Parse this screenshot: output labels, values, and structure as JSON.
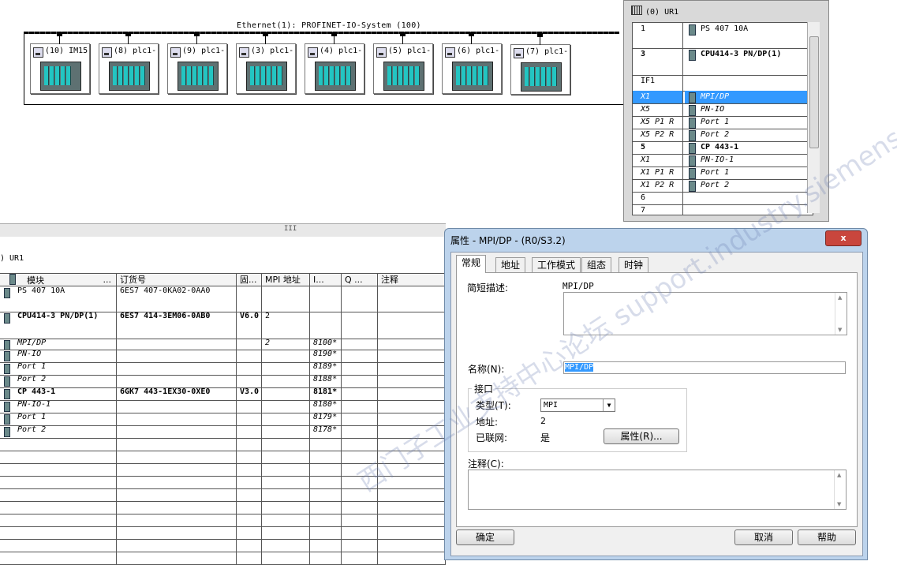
{
  "network": {
    "label": "Ethernet(1): PROFINET-IO-System (100)",
    "devices": [
      "(10) IM15",
      "(8) plc1-",
      "(9) plc1-",
      "(3) plc1-",
      "(4) plc1-",
      "(5) plc1-",
      "(6) plc1-",
      "(7) plc1-"
    ]
  },
  "rack": {
    "title": "(0) UR1",
    "rows": [
      {
        "slot": "1",
        "module": "PS 407 10A"
      },
      {
        "slot": "3",
        "module": "CPU414-3 PN/DP(1)"
      },
      {
        "slot": "IF1",
        "module": ""
      },
      {
        "slot": "X1",
        "module": "MPI/DP"
      },
      {
        "slot": "X5",
        "module": "PN-IO"
      },
      {
        "slot": "X5 P1 R",
        "module": "Port 1"
      },
      {
        "slot": "X5 P2 R",
        "module": "Port 2"
      },
      {
        "slot": "5",
        "module": "CP 443-1"
      },
      {
        "slot": "X1",
        "module": "PN-IO-1"
      },
      {
        "slot": "X1 P1 R",
        "module": "Port 1"
      },
      {
        "slot": "X1 P2 R",
        "module": "Port 2"
      },
      {
        "slot": "6",
        "module": ""
      },
      {
        "slot": "7",
        "module": ""
      }
    ]
  },
  "splitter": {
    "grip": "III"
  },
  "table": {
    "rack_label": ")   UR1",
    "headers": {
      "module": "模块",
      "dots": "...",
      "order": "订货号",
      "firmware": "固...",
      "mpi": "MPI 地址",
      "i": "I...",
      "q": "Q ...",
      "comment": "注释"
    },
    "rows": [
      {
        "module": "PS 407 10A",
        "order": "6ES7 407-0KA02-0AA0",
        "firmware": "",
        "mpi": "",
        "i": ""
      },
      {
        "module": "CPU414-3 PN/DP(1)",
        "order": "6ES7 414-3EM06-0AB0",
        "firmware": "V6.0",
        "mpi": "2",
        "i": ""
      },
      {
        "module": "MPI/DP",
        "order": "",
        "firmware": "",
        "mpi": "2",
        "i": "8100*"
      },
      {
        "module": "PN-IO",
        "order": "",
        "firmware": "",
        "mpi": "",
        "i": "8190*"
      },
      {
        "module": "Port 1",
        "order": "",
        "firmware": "",
        "mpi": "",
        "i": "8189*"
      },
      {
        "module": "Port 2",
        "order": "",
        "firmware": "",
        "mpi": "",
        "i": "8188*"
      },
      {
        "module": "CP 443-1",
        "order": "6GK7 443-1EX30-0XE0",
        "firmware": "V3.0",
        "mpi": "",
        "i": "8181*"
      },
      {
        "module": "PN-IO-1",
        "order": "",
        "firmware": "",
        "mpi": "",
        "i": "8180*"
      },
      {
        "module": "Port 1",
        "order": "",
        "firmware": "",
        "mpi": "",
        "i": "8179*"
      },
      {
        "module": "Port 2",
        "order": "",
        "firmware": "",
        "mpi": "",
        "i": "8178*"
      }
    ]
  },
  "dialog": {
    "title": "属性 - MPI/DP - (R0/S3.2)",
    "close": "x",
    "tabs": [
      "常规",
      "地址",
      "工作模式",
      "组态",
      "时钟"
    ],
    "short_desc_label": "简短描述:",
    "short_desc_value": "MPI/DP",
    "name_label": "名称(N):",
    "name_value": "MPI/DP",
    "interface_group": "接口",
    "type_label": "类型(T):",
    "type_value": "MPI",
    "address_label": "地址:",
    "address_value": "2",
    "networked_label": "已联网:",
    "networked_value": "是",
    "properties_button": "属性(R)...",
    "comment_label": "注释(C):",
    "ok_button": "确定",
    "cancel_button": "取消",
    "help_button": "帮助"
  },
  "watermark": "西门子工业支持中心论坛 support.industry.siemens.com/cs"
}
